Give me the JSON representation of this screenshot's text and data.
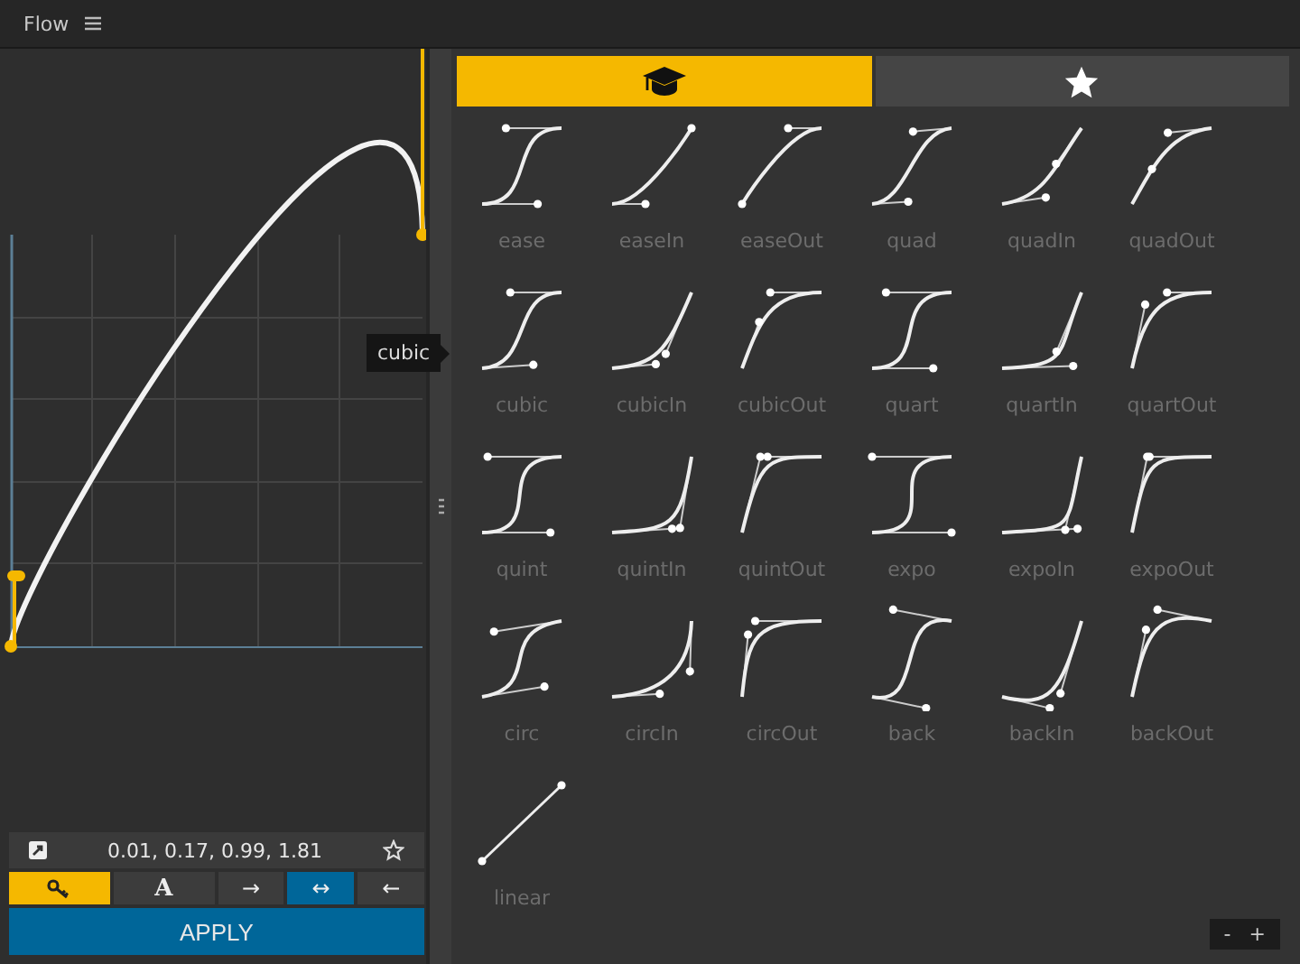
{
  "window": {
    "title": "Flow"
  },
  "graph": {
    "tooltip": "cubic"
  },
  "bezier_values": "0.01, 0.17, 0.99, 1.81",
  "mode_buttons": [
    {
      "kind": "key",
      "selected": true
    },
    {
      "kind": "text",
      "label": "A",
      "selected": false
    }
  ],
  "direction_buttons": [
    {
      "label": "→",
      "selected": false
    },
    {
      "label": "↔",
      "selected": true
    },
    {
      "label": "←",
      "selected": false
    }
  ],
  "apply_button": "APPLY",
  "tabs": [
    {
      "kind": "graduation-cap",
      "selected": true
    },
    {
      "kind": "star",
      "selected": false
    }
  ],
  "presets": [
    {
      "label": "ease"
    },
    {
      "label": "easeIn"
    },
    {
      "label": "easeOut"
    },
    {
      "label": "quad"
    },
    {
      "label": "quadIn"
    },
    {
      "label": "quadOut"
    },
    {
      "label": "cubic"
    },
    {
      "label": "cubicIn"
    },
    {
      "label": "cubicOut"
    },
    {
      "label": "quart"
    },
    {
      "label": "quartIn"
    },
    {
      "label": "quartOut"
    },
    {
      "label": "quint"
    },
    {
      "label": "quintIn"
    },
    {
      "label": "quintOut"
    },
    {
      "label": "expo"
    },
    {
      "label": "expoIn"
    },
    {
      "label": "expoOut"
    },
    {
      "label": "circ"
    },
    {
      "label": "circIn"
    },
    {
      "label": "circOut"
    },
    {
      "label": "back"
    },
    {
      "label": "backIn"
    },
    {
      "label": "backOut"
    },
    {
      "label": "linear"
    }
  ],
  "zoom_buttons": [
    "-",
    "+"
  ]
}
